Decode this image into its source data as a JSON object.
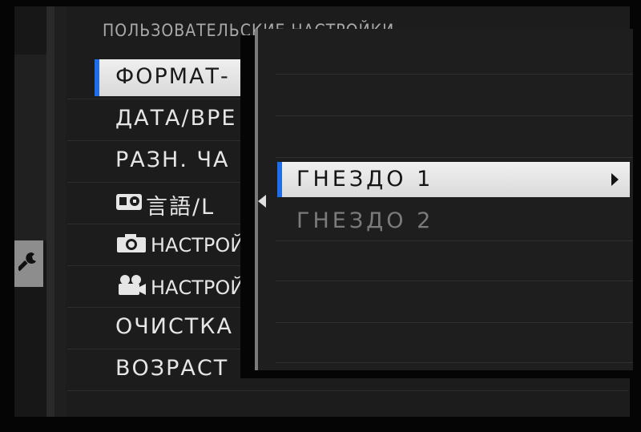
{
  "header": {
    "title": "ПОЛЬЗОВАТЕЛЬСКИЕ НАСТРОЙКИ"
  },
  "left_tab": {
    "icon": "wrench-icon"
  },
  "menu": {
    "items": [
      {
        "label": "ФОРМАТ-",
        "selected": true
      },
      {
        "label": "ДАТА/ВРЕ"
      },
      {
        "label": "РАЗН. ЧА"
      },
      {
        "label": "言語/L",
        "icon": "language-icon"
      },
      {
        "label": "НАСТРОЙ",
        "icon": "camera-icon"
      },
      {
        "label": "НАСТРОЙ",
        "icon": "movie-camera-icon"
      },
      {
        "label": "ОЧИСТКА"
      },
      {
        "label": "ВОЗРАСТ"
      }
    ]
  },
  "submenu": {
    "items": [
      {
        "label": "ГНЕЗДО 1",
        "selected": true,
        "has_arrow": true
      },
      {
        "label": "ГНЕЗДО 2",
        "disabled": true
      }
    ]
  },
  "colors": {
    "accent": "#1f6ee8",
    "highlight": "#e8e8e8",
    "background": "#1c1c1c"
  }
}
